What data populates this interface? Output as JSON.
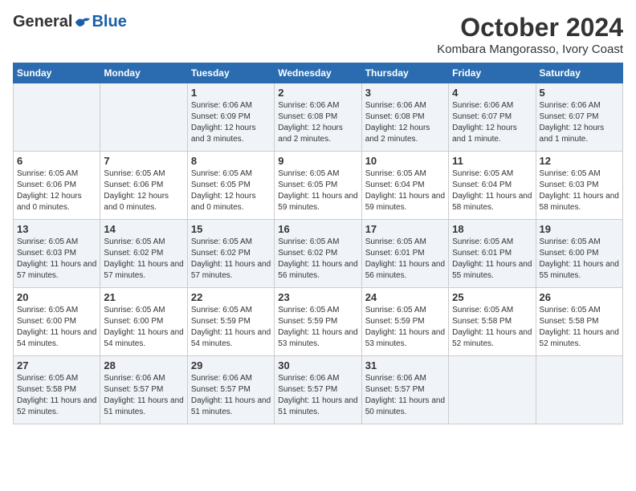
{
  "header": {
    "logo_general": "General",
    "logo_blue": "Blue",
    "month_title": "October 2024",
    "location": "Kombara Mangorasso, Ivory Coast"
  },
  "weekdays": [
    "Sunday",
    "Monday",
    "Tuesday",
    "Wednesday",
    "Thursday",
    "Friday",
    "Saturday"
  ],
  "weeks": [
    [
      {
        "day": "",
        "detail": ""
      },
      {
        "day": "",
        "detail": ""
      },
      {
        "day": "1",
        "detail": "Sunrise: 6:06 AM\nSunset: 6:09 PM\nDaylight: 12 hours and 3 minutes."
      },
      {
        "day": "2",
        "detail": "Sunrise: 6:06 AM\nSunset: 6:08 PM\nDaylight: 12 hours and 2 minutes."
      },
      {
        "day": "3",
        "detail": "Sunrise: 6:06 AM\nSunset: 6:08 PM\nDaylight: 12 hours and 2 minutes."
      },
      {
        "day": "4",
        "detail": "Sunrise: 6:06 AM\nSunset: 6:07 PM\nDaylight: 12 hours and 1 minute."
      },
      {
        "day": "5",
        "detail": "Sunrise: 6:06 AM\nSunset: 6:07 PM\nDaylight: 12 hours and 1 minute."
      }
    ],
    [
      {
        "day": "6",
        "detail": "Sunrise: 6:05 AM\nSunset: 6:06 PM\nDaylight: 12 hours and 0 minutes."
      },
      {
        "day": "7",
        "detail": "Sunrise: 6:05 AM\nSunset: 6:06 PM\nDaylight: 12 hours and 0 minutes."
      },
      {
        "day": "8",
        "detail": "Sunrise: 6:05 AM\nSunset: 6:05 PM\nDaylight: 12 hours and 0 minutes."
      },
      {
        "day": "9",
        "detail": "Sunrise: 6:05 AM\nSunset: 6:05 PM\nDaylight: 11 hours and 59 minutes."
      },
      {
        "day": "10",
        "detail": "Sunrise: 6:05 AM\nSunset: 6:04 PM\nDaylight: 11 hours and 59 minutes."
      },
      {
        "day": "11",
        "detail": "Sunrise: 6:05 AM\nSunset: 6:04 PM\nDaylight: 11 hours and 58 minutes."
      },
      {
        "day": "12",
        "detail": "Sunrise: 6:05 AM\nSunset: 6:03 PM\nDaylight: 11 hours and 58 minutes."
      }
    ],
    [
      {
        "day": "13",
        "detail": "Sunrise: 6:05 AM\nSunset: 6:03 PM\nDaylight: 11 hours and 57 minutes."
      },
      {
        "day": "14",
        "detail": "Sunrise: 6:05 AM\nSunset: 6:02 PM\nDaylight: 11 hours and 57 minutes."
      },
      {
        "day": "15",
        "detail": "Sunrise: 6:05 AM\nSunset: 6:02 PM\nDaylight: 11 hours and 57 minutes."
      },
      {
        "day": "16",
        "detail": "Sunrise: 6:05 AM\nSunset: 6:02 PM\nDaylight: 11 hours and 56 minutes."
      },
      {
        "day": "17",
        "detail": "Sunrise: 6:05 AM\nSunset: 6:01 PM\nDaylight: 11 hours and 56 minutes."
      },
      {
        "day": "18",
        "detail": "Sunrise: 6:05 AM\nSunset: 6:01 PM\nDaylight: 11 hours and 55 minutes."
      },
      {
        "day": "19",
        "detail": "Sunrise: 6:05 AM\nSunset: 6:00 PM\nDaylight: 11 hours and 55 minutes."
      }
    ],
    [
      {
        "day": "20",
        "detail": "Sunrise: 6:05 AM\nSunset: 6:00 PM\nDaylight: 11 hours and 54 minutes."
      },
      {
        "day": "21",
        "detail": "Sunrise: 6:05 AM\nSunset: 6:00 PM\nDaylight: 11 hours and 54 minutes."
      },
      {
        "day": "22",
        "detail": "Sunrise: 6:05 AM\nSunset: 5:59 PM\nDaylight: 11 hours and 54 minutes."
      },
      {
        "day": "23",
        "detail": "Sunrise: 6:05 AM\nSunset: 5:59 PM\nDaylight: 11 hours and 53 minutes."
      },
      {
        "day": "24",
        "detail": "Sunrise: 6:05 AM\nSunset: 5:59 PM\nDaylight: 11 hours and 53 minutes."
      },
      {
        "day": "25",
        "detail": "Sunrise: 6:05 AM\nSunset: 5:58 PM\nDaylight: 11 hours and 52 minutes."
      },
      {
        "day": "26",
        "detail": "Sunrise: 6:05 AM\nSunset: 5:58 PM\nDaylight: 11 hours and 52 minutes."
      }
    ],
    [
      {
        "day": "27",
        "detail": "Sunrise: 6:05 AM\nSunset: 5:58 PM\nDaylight: 11 hours and 52 minutes."
      },
      {
        "day": "28",
        "detail": "Sunrise: 6:06 AM\nSunset: 5:57 PM\nDaylight: 11 hours and 51 minutes."
      },
      {
        "day": "29",
        "detail": "Sunrise: 6:06 AM\nSunset: 5:57 PM\nDaylight: 11 hours and 51 minutes."
      },
      {
        "day": "30",
        "detail": "Sunrise: 6:06 AM\nSunset: 5:57 PM\nDaylight: 11 hours and 51 minutes."
      },
      {
        "day": "31",
        "detail": "Sunrise: 6:06 AM\nSunset: 5:57 PM\nDaylight: 11 hours and 50 minutes."
      },
      {
        "day": "",
        "detail": ""
      },
      {
        "day": "",
        "detail": ""
      }
    ]
  ]
}
